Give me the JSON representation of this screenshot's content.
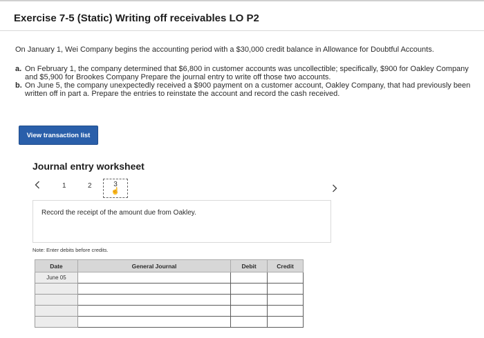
{
  "header": {
    "title": "Exercise 7-5 (Static) Writing off receivables LO P2"
  },
  "problem": {
    "intro": "On January 1, Wei Company begins the accounting period with a $30,000 credit balance in Allowance for Doubtful Accounts.",
    "parts": [
      {
        "letter": "a.",
        "text": "On February 1, the company determined that $6,800 in customer accounts was uncollectible; specifically, $900 for Oakley Company and $5,900 for Brookes Company Prepare the journal entry to write off those two accounts."
      },
      {
        "letter": "b.",
        "text": "On June 5, the company unexpectedly received a $900 payment on a customer account, Oakley Company, that had previously been written off in part a. Prepare the entries to reinstate the account and record the cash received."
      }
    ]
  },
  "toolbar": {
    "view_label": "View transaction list"
  },
  "worksheet": {
    "title": "Journal entry worksheet",
    "steps": [
      "1",
      "2",
      "3"
    ],
    "active_step": 3,
    "instruction": "Record the receipt of the amount due from Oakley.",
    "note": "Note: Enter debits before credits."
  },
  "journal": {
    "headers": {
      "date": "Date",
      "general_journal": "General Journal",
      "debit": "Debit",
      "credit": "Credit"
    },
    "rows": [
      {
        "date": "June 05"
      },
      {
        "date": ""
      },
      {
        "date": ""
      },
      {
        "date": ""
      },
      {
        "date": ""
      }
    ]
  },
  "colors": {
    "button_blue": "#2a5faa",
    "header_gray": "#d7d7d7"
  },
  "icons": {
    "prev": "chevron-left-icon",
    "next": "chevron-right-icon",
    "cursor": "hand-pointer-icon"
  }
}
